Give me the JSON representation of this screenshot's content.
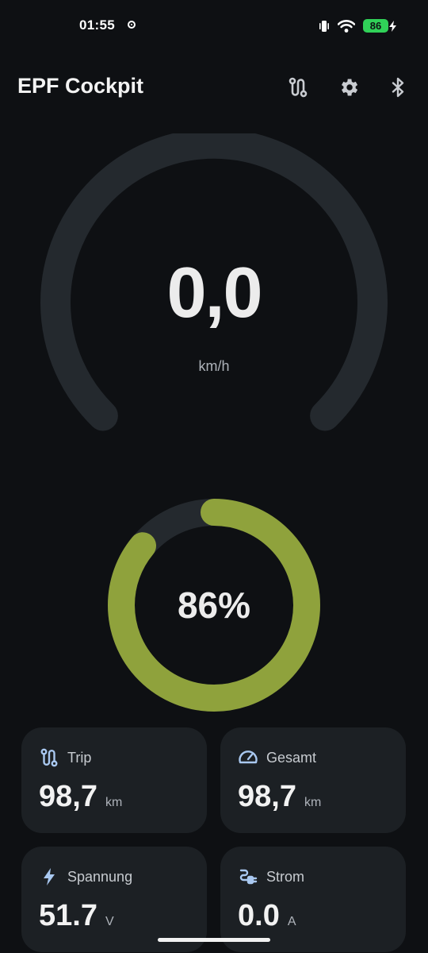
{
  "status_bar": {
    "time": "01:55",
    "battery": "86"
  },
  "header": {
    "title": "EPF Cockpit",
    "icons": [
      "route-icon",
      "gear-icon",
      "bluetooth-icon"
    ]
  },
  "speed": {
    "value": "0,0",
    "unit": "km/h",
    "level": 0
  },
  "battery_gauge": {
    "value": "86%",
    "level": 0.86,
    "color": "#8fa23c"
  },
  "cards": [
    {
      "label": "Trip",
      "value": "98,7",
      "unit": "km",
      "icon": "route-icon"
    },
    {
      "label": "Gesamt",
      "value": "98,7",
      "unit": "km",
      "icon": "speedometer-icon"
    },
    {
      "label": "Spannung",
      "value": "51.7",
      "unit": "V",
      "icon": "lightning-icon"
    },
    {
      "label": "Strom",
      "value": "0.0",
      "unit": "A",
      "icon": "plug-icon"
    }
  ],
  "colors": {
    "background": "#0e1013",
    "card": "#1c2024",
    "gauge_track": "#24292e",
    "accent": "#8fa23c",
    "icon_blue": "#a9c8f0"
  }
}
